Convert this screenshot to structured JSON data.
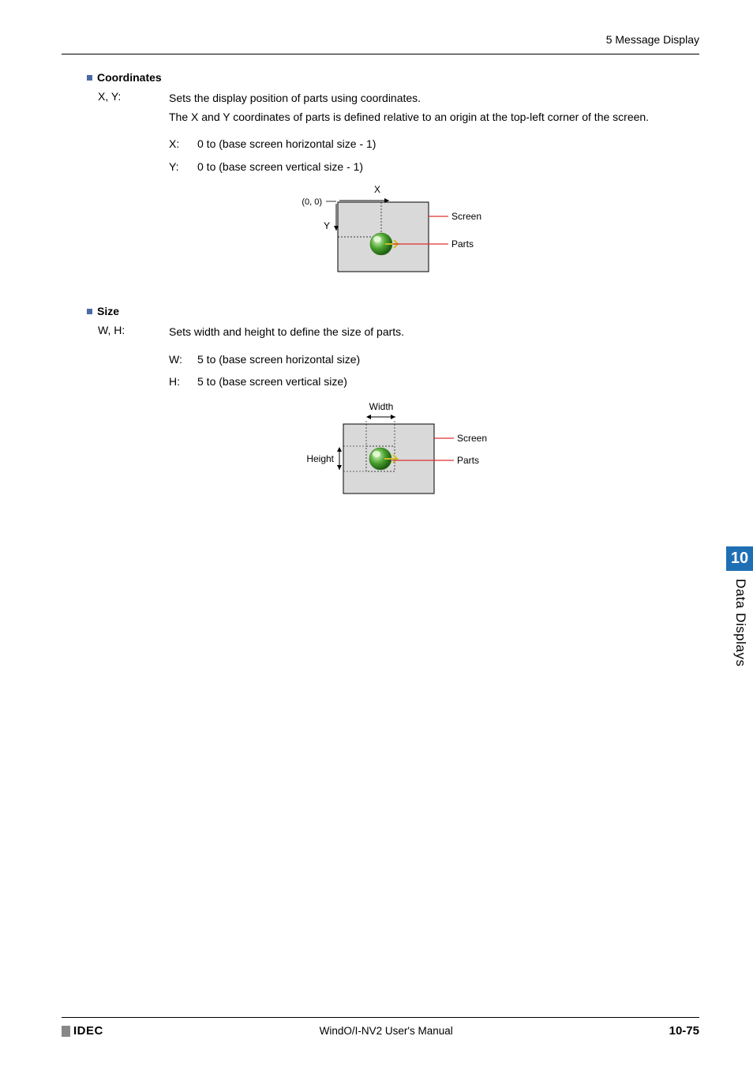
{
  "header": {
    "title": "5 Message Display"
  },
  "sections": {
    "coordinates": {
      "title": "Coordinates",
      "label": "X, Y:",
      "desc1": "Sets the display position of parts using coordinates.",
      "desc2": "The X and Y coordinates of parts is defined relative to an origin at the top-left corner of the screen.",
      "items": [
        {
          "key": "X:",
          "val": "0 to (base screen horizontal size - 1)"
        },
        {
          "key": "Y:",
          "val": "0 to (base screen vertical size - 1)"
        }
      ],
      "diagram": {
        "origin": "(0, 0)",
        "x": "X",
        "y": "Y",
        "screen": "Screen",
        "parts": "Parts"
      }
    },
    "size": {
      "title": "Size",
      "label": "W, H:",
      "desc1": "Sets width and height to define the size of parts.",
      "items": [
        {
          "key": "W:",
          "val": "5 to (base screen horizontal size)"
        },
        {
          "key": "H:",
          "val": "5 to (base screen vertical size)"
        }
      ],
      "diagram": {
        "width": "Width",
        "height": "Height",
        "screen": "Screen",
        "parts": "Parts"
      }
    }
  },
  "sidetab": {
    "num": "10",
    "text": "Data Displays"
  },
  "footer": {
    "logo": "IDEC",
    "center": "WindO/I-NV2 User's Manual",
    "right": "10-75"
  }
}
